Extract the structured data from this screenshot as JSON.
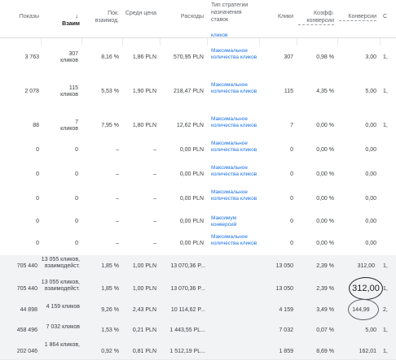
{
  "headers": {
    "impressions": "Показы",
    "interactions": "Взаим",
    "interaction_rate": "Пок. взаимод.",
    "avg_cost": "Средн цена",
    "cost": "Расходы",
    "bid_strategy_type": "Тип стратегии назначения ставок",
    "clicks": "Клики",
    "conv_rate": "Коэфф. конверсии",
    "conversions": "Конверсии",
    "cut": "С"
  },
  "top_fragment": "кликов",
  "rows": [
    {
      "impressions": "3 763",
      "interactions": "307",
      "interactions_unit": "кликов",
      "rate": "8,16 %",
      "avg": "1,86 PLN",
      "cost": "570,95 PLN",
      "strategy": "Максимальное количества кликов",
      "clicks": "307",
      "conv_rate": "0,98 %",
      "conversions": "3,00",
      "cut": "1,"
    },
    {
      "impressions": "2 078",
      "interactions": "115",
      "interactions_unit": "кликов",
      "rate": "5,53 %",
      "avg": "1,90 PLN",
      "cost": "218,47 PLN",
      "strategy": "Максимальное количества кликов",
      "clicks": "115",
      "conv_rate": "4,35 %",
      "conversions": "5,00",
      "cut": "1,"
    },
    {
      "impressions": "88",
      "interactions": "7",
      "interactions_unit": "кликов",
      "rate": "7,95 %",
      "avg": "1,80 PLN",
      "cost": "12,62 PLN",
      "strategy": "Максимальное количества кликов",
      "clicks": "7",
      "conv_rate": "0,00 %",
      "conversions": "0,00",
      "cut": "1,"
    },
    {
      "impressions": "0",
      "interactions": "0",
      "interactions_unit": "",
      "rate": "–",
      "avg": "–",
      "cost": "0,00 PLN",
      "strategy": "Максимальное количества кликов",
      "clicks": "0",
      "conv_rate": "0,00 %",
      "conversions": "0,00",
      "cut": ""
    },
    {
      "impressions": "0",
      "interactions": "0",
      "interactions_unit": "",
      "rate": "–",
      "avg": "–",
      "cost": "0,00 PLN",
      "strategy": "Максимальное количества кликов",
      "clicks": "0",
      "conv_rate": "0,00 %",
      "conversions": "0,00",
      "cut": ""
    },
    {
      "impressions": "0",
      "interactions": "0",
      "interactions_unit": "",
      "rate": "–",
      "avg": "–",
      "cost": "0,00 PLN",
      "strategy": "Максимальное количества кликов",
      "clicks": "0",
      "conv_rate": "0,00 %",
      "conversions": "0,00",
      "cut": ""
    },
    {
      "impressions": "0",
      "interactions": "0",
      "interactions_unit": "",
      "rate": "–",
      "avg": "–",
      "cost": "0,00 PLN",
      "strategy": "Максимум конверсий",
      "clicks": "0",
      "conv_rate": "0,00 %",
      "conversions": "0,00",
      "cut": ""
    },
    {
      "impressions": "0",
      "interactions": "0",
      "interactions_unit": "",
      "rate": "–",
      "avg": "–",
      "cost": "0,00 PLN",
      "strategy": "Максимальное количества кликов",
      "clicks": "0",
      "conv_rate": "0,00 %",
      "conversions": "0,00",
      "cut": ""
    }
  ],
  "totals": [
    {
      "impressions": "705 440",
      "interactions": "13 055 кликов, взаимодейст.",
      "rate": "1,85 %",
      "avg": "1,00 PLN",
      "cost": "13 070,36 P...",
      "clicks": "13 050",
      "conv_rate": "2,39 %",
      "conversions": "312,00",
      "cut": "1,"
    },
    {
      "impressions": "705 440",
      "interactions": "13 055 кликов, взаимодейст.",
      "rate": "1,85 %",
      "avg": "1,00 PLN",
      "cost": "13 070,36 P...",
      "clicks": "13 050",
      "conv_rate": "2,39 %",
      "conversions": "312,00",
      "cut": "1,"
    },
    {
      "impressions": "44 898",
      "interactions": "4 159 кликов",
      "rate": "9,26 %",
      "avg": "2,43 PLN",
      "cost": "10 114,62 P...",
      "clicks": "4 159",
      "conv_rate": "3,49 %",
      "conversions": "144,99",
      "cut": "2,"
    },
    {
      "impressions": "458 496",
      "interactions": "7 032 кликов",
      "rate": "1,53 %",
      "avg": "0,21 PLN",
      "cost": "1 443,55 PL...",
      "clicks": "7 032",
      "conv_rate": "0,07 %",
      "conversions": "5,00",
      "cut": "1,"
    },
    {
      "impressions": "202 046",
      "interactions": "1 864 кликов,",
      "rate": "0,92 %",
      "avg": "0,81 PLN",
      "cost": "1 512,19 PL...",
      "clicks": "1 859",
      "conv_rate": "8,69 %",
      "conversions": "162,01",
      "cut": "1,"
    }
  ]
}
